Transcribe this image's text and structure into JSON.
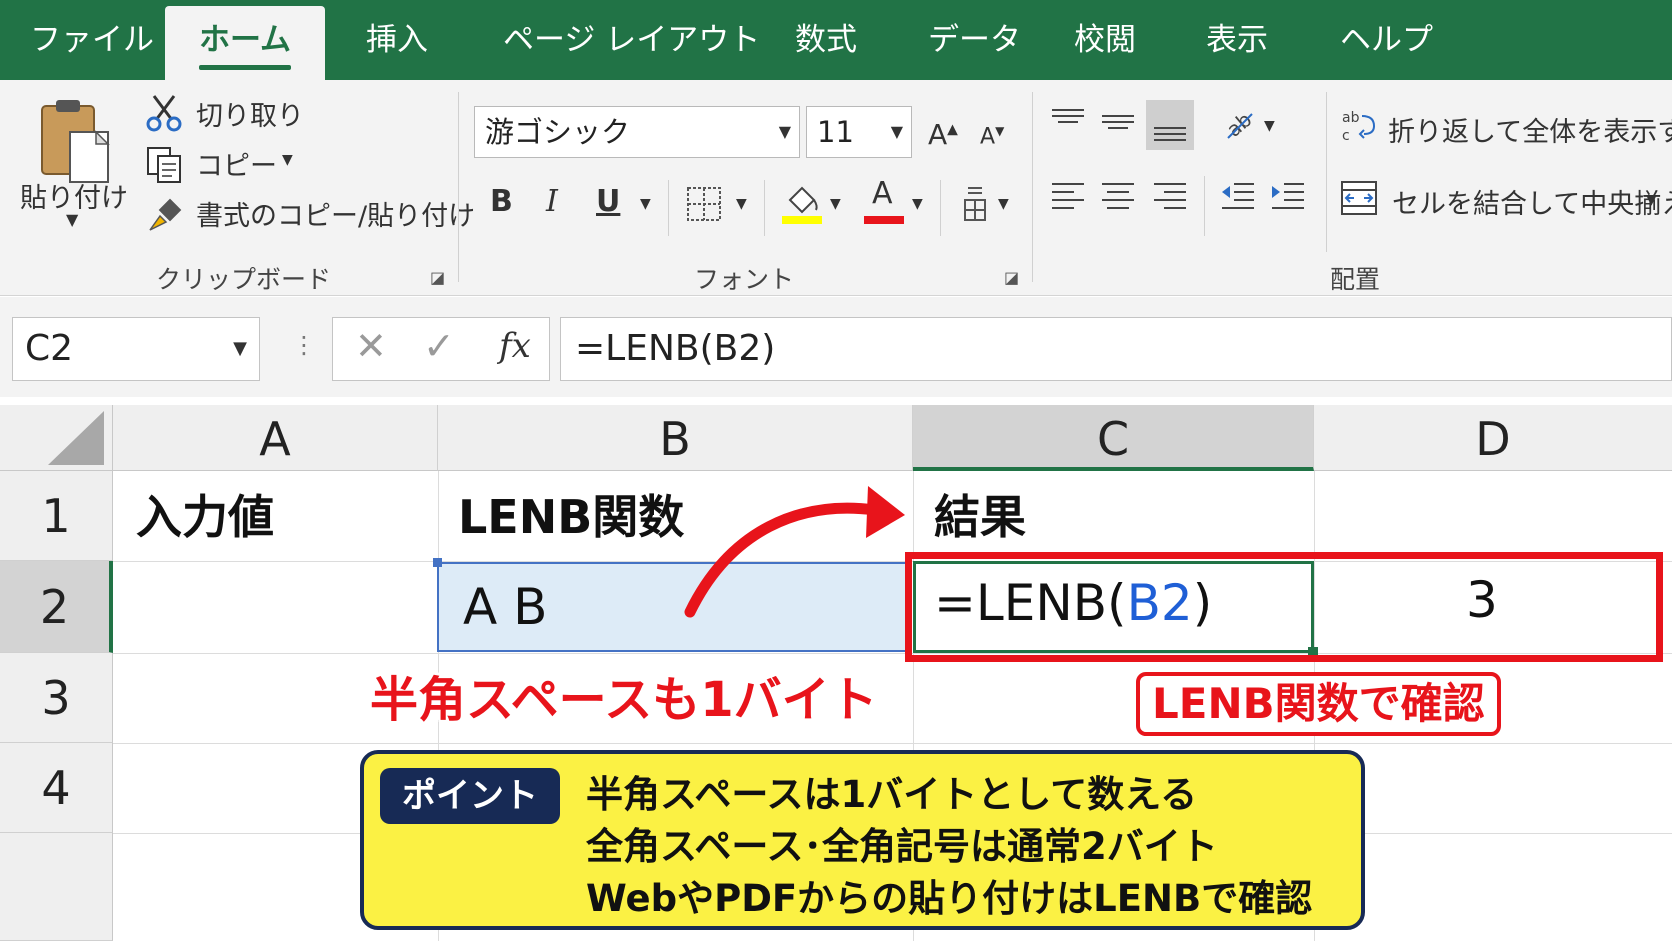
{
  "tabs": [
    "ファイル",
    "ホーム",
    "挿入",
    "ページ レイアウト",
    "数式",
    "データ",
    "校閲",
    "表示",
    "ヘルプ"
  ],
  "active_tab": "ホーム",
  "clipboard": {
    "paste_label": "貼り付け",
    "cut_label": "切り取り",
    "copy_label": "コピー",
    "format_painter_label": "書式のコピー/貼り付け",
    "group_label": "クリップボード"
  },
  "font": {
    "font_name": "游ゴシック",
    "font_size": "11",
    "bold": "B",
    "italic": "I",
    "underline": "U",
    "increase_size": "A",
    "decrease_size": "A",
    "font_color_glyph": "A",
    "group_label": "フォント"
  },
  "alignment": {
    "wrap_text_label": "折り返して全体を表示する",
    "merge_center_label": "セルを結合して中央揃え",
    "group_label": "配置"
  },
  "formula_bar": {
    "name_box": "C2",
    "formula": "=LENB(B2)",
    "fx_label": "fx"
  },
  "grid": {
    "columns": [
      "A",
      "B",
      "C",
      "D"
    ],
    "rows": [
      "1",
      "2",
      "3",
      "4"
    ],
    "selected_column": "C",
    "selected_row": "2",
    "cells": {
      "A1": "入力値",
      "B1": "LENB関数",
      "C1": "結果",
      "B2": "A B",
      "C2_prefix": "=LENB(",
      "C2_ref": "B2",
      "C2_suffix": ")",
      "D2": "3"
    }
  },
  "annotations": {
    "half_width_space": "半角スペースも1バイト",
    "lenb_check": "LENB関数で確認"
  },
  "point_box": {
    "badge": "ポイント",
    "lines": [
      "半角スペースは1バイトとして数える",
      "全角スペース･全角記号は通常2バイト",
      "WebやPDFからの貼り付けはLENBで確認"
    ]
  },
  "colors": {
    "excel_green": "#217346",
    "annotation_red": "#e8141b",
    "point_yellow": "#fbf144",
    "point_navy": "#172a55",
    "reference_blue": "#1f5fd6",
    "selection_blue": "#ddebf7"
  }
}
